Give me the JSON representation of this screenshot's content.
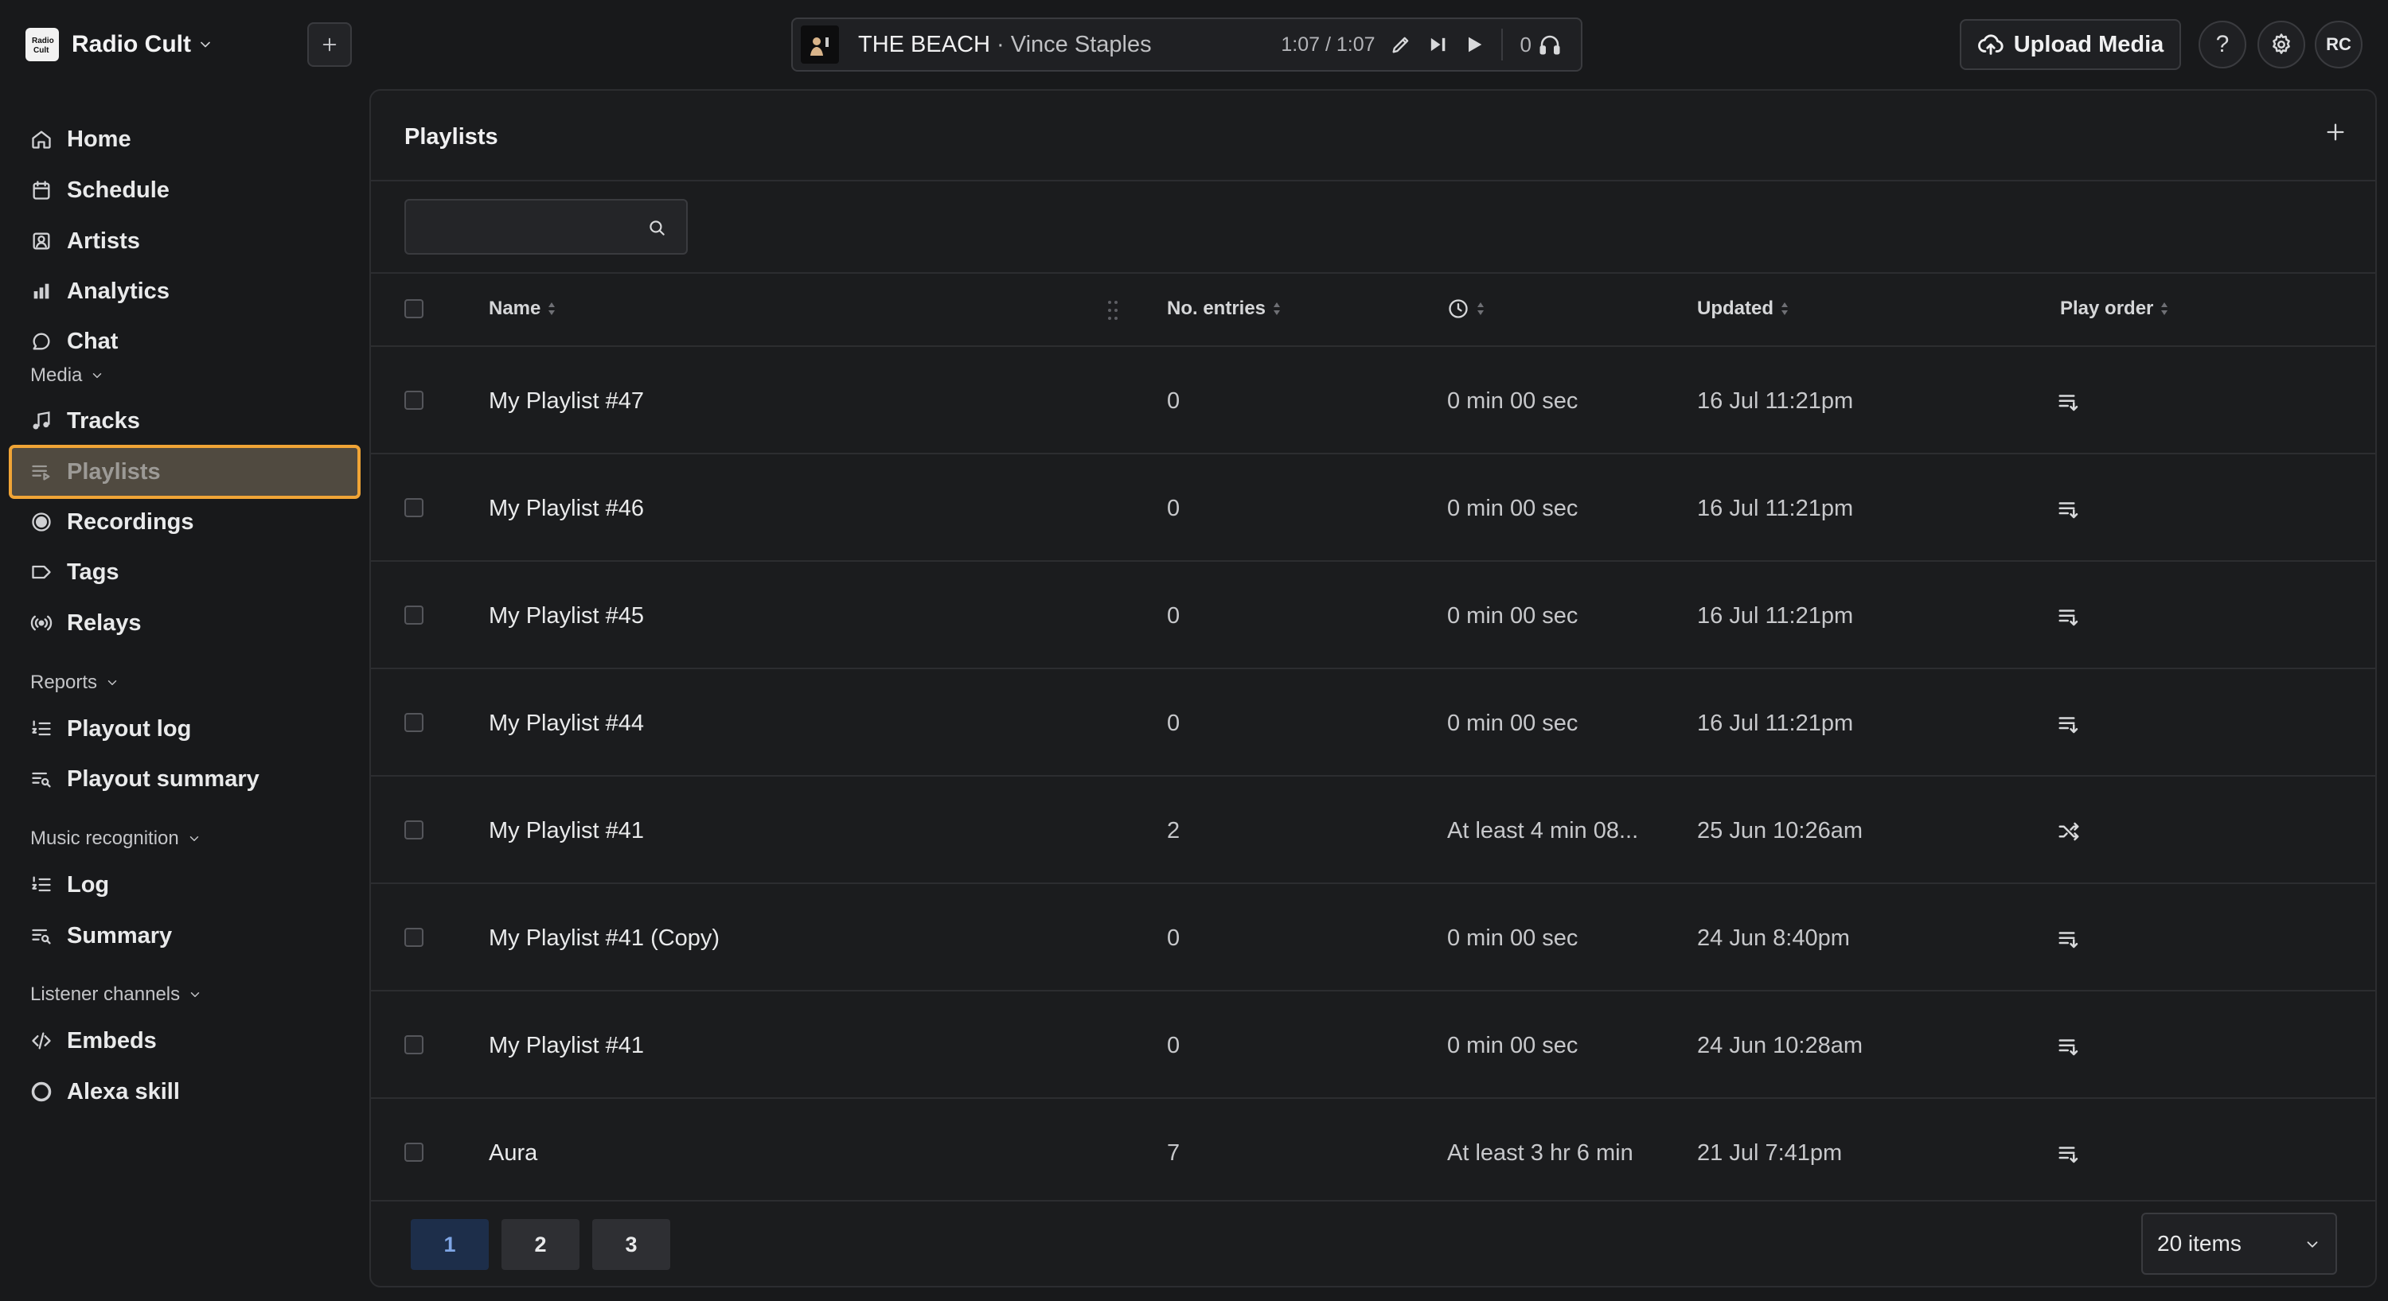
{
  "app": {
    "name": "Radio Cult",
    "logo_text": "Radio Cult"
  },
  "player": {
    "title": "THE BEACH",
    "separator": "·",
    "artist": "Vince Staples",
    "time": "1:07 / 1:07",
    "listeners": "0"
  },
  "header": {
    "upload_label": "Upload Media",
    "help": "?",
    "avatar": "RC"
  },
  "sidebar": {
    "main": [
      {
        "label": "Home",
        "icon": "home-icon"
      },
      {
        "label": "Schedule",
        "icon": "calendar-icon"
      },
      {
        "label": "Artists",
        "icon": "artist-icon"
      },
      {
        "label": "Analytics",
        "icon": "bar-chart-icon"
      },
      {
        "label": "Chat",
        "icon": "chat-icon"
      }
    ],
    "media_section": "Media",
    "media": [
      {
        "label": "Tracks",
        "icon": "music-note-icon"
      },
      {
        "label": "Playlists",
        "icon": "playlist-icon",
        "active": true
      },
      {
        "label": "Recordings",
        "icon": "record-icon"
      },
      {
        "label": "Tags",
        "icon": "tag-icon"
      },
      {
        "label": "Relays",
        "icon": "broadcast-icon"
      }
    ],
    "reports_section": "Reports",
    "reports": [
      {
        "label": "Playout log",
        "icon": "numbered-list-icon"
      },
      {
        "label": "Playout summary",
        "icon": "list-search-icon"
      }
    ],
    "music_section": "Music recognition",
    "music": [
      {
        "label": "Log",
        "icon": "numbered-list-icon"
      },
      {
        "label": "Summary",
        "icon": "list-search-icon"
      }
    ],
    "listener_section": "Listener channels",
    "listener": [
      {
        "label": "Embeds",
        "icon": "code-icon"
      },
      {
        "label": "Alexa skill",
        "icon": "alexa-icon"
      }
    ]
  },
  "main": {
    "title": "Playlists",
    "search_placeholder": "",
    "columns": {
      "name": "Name",
      "entries": "No. entries",
      "duration_icon": "clock-icon",
      "updated": "Updated",
      "play_order": "Play order"
    },
    "rows": [
      {
        "name": "My Playlist #47",
        "entries": "0",
        "duration": "0 min 00 sec",
        "updated": "16 Jul 11:21pm",
        "order": "sequential"
      },
      {
        "name": "My Playlist #46",
        "entries": "0",
        "duration": "0 min 00 sec",
        "updated": "16 Jul 11:21pm",
        "order": "sequential"
      },
      {
        "name": "My Playlist #45",
        "entries": "0",
        "duration": "0 min 00 sec",
        "updated": "16 Jul 11:21pm",
        "order": "sequential"
      },
      {
        "name": "My Playlist #44",
        "entries": "0",
        "duration": "0 min 00 sec",
        "updated": "16 Jul 11:21pm",
        "order": "sequential"
      },
      {
        "name": "My Playlist #41",
        "entries": "2",
        "duration": "At least 4 min 08...",
        "updated": "25 Jun 10:26am",
        "order": "shuffle"
      },
      {
        "name": "My Playlist #41 (Copy)",
        "entries": "0",
        "duration": "0 min 00 sec",
        "updated": "24 Jun 8:40pm",
        "order": "sequential"
      },
      {
        "name": "My Playlist #41",
        "entries": "0",
        "duration": "0 min 00 sec",
        "updated": "24 Jun 10:28am",
        "order": "sequential"
      },
      {
        "name": "Aura",
        "entries": "7",
        "duration": "At least 3 hr 6 min",
        "updated": "21 Jul 7:41pm",
        "order": "sequential"
      }
    ],
    "pages": [
      "1",
      "2",
      "3"
    ],
    "current_page": "1",
    "items_per_page": "20 items"
  },
  "colors": {
    "accent_outline": "#f0a436",
    "current_page": "#1d2e4a"
  }
}
